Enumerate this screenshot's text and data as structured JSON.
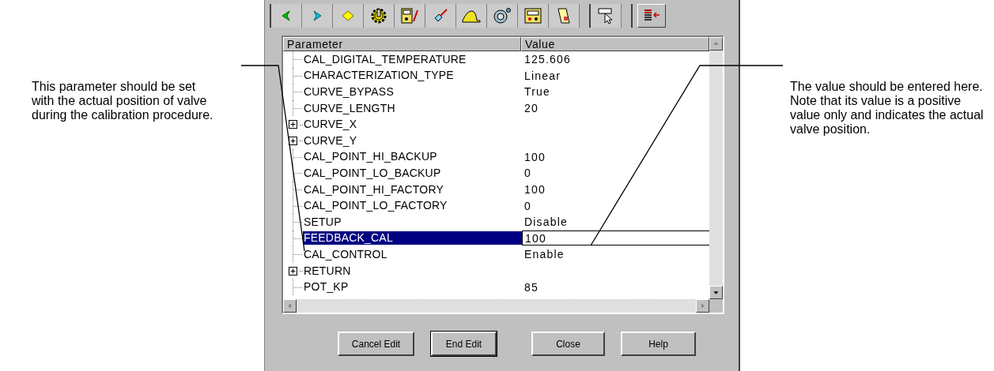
{
  "callouts": [
    {
      "text": "This parameter should be set with the actual position of valve during the calibration procedure."
    },
    {
      "text": "The value should be entered here. Note that its value is a positive value only and indicates the actual valve position."
    }
  ],
  "table": {
    "columns": [
      "Parameter",
      "Value"
    ],
    "rows": [
      {
        "name": "CAL_DIGITAL_TEMPERATURE",
        "value": "125.606",
        "kind": "leaf",
        "selected": false
      },
      {
        "name": "CHARACTERIZATION_TYPE",
        "value": "Linear",
        "kind": "leaf",
        "selected": false
      },
      {
        "name": "CURVE_BYPASS",
        "value": "True",
        "kind": "leaf",
        "selected": false
      },
      {
        "name": "CURVE_LENGTH",
        "value": "20",
        "kind": "leaf",
        "selected": false
      },
      {
        "name": "CURVE_X",
        "kind": "group",
        "selected": false
      },
      {
        "name": "CURVE_Y",
        "kind": "group",
        "selected": false
      },
      {
        "name": "CAL_POINT_HI_BACKUP",
        "value": "100",
        "kind": "leaf",
        "selected": false
      },
      {
        "name": "CAL_POINT_LO_BACKUP",
        "value": "0",
        "kind": "leaf",
        "selected": false
      },
      {
        "name": "CAL_POINT_HI_FACTORY",
        "value": "100",
        "kind": "leaf",
        "selected": false
      },
      {
        "name": "CAL_POINT_LO_FACTORY",
        "value": "0",
        "kind": "leaf",
        "selected": false
      },
      {
        "name": "SETUP",
        "value": "Disable",
        "kind": "leaf",
        "selected": false
      },
      {
        "name": "FEEDBACK_CAL",
        "value": "100",
        "kind": "leaf",
        "selected": true
      },
      {
        "name": "CAL_CONTROL",
        "value": "Enable",
        "kind": "leaf",
        "selected": false
      },
      {
        "name": "RETURN",
        "kind": "group",
        "selected": false
      },
      {
        "name": "POT_KP",
        "value": "85",
        "kind": "leaf",
        "selected": false
      }
    ]
  },
  "buttons": [
    {
      "label": "Cancel Edit",
      "default": false
    },
    {
      "label": "End Edit",
      "default": true
    },
    {
      "label": "Close",
      "default": false
    },
    {
      "label": "Help",
      "default": false
    }
  ]
}
